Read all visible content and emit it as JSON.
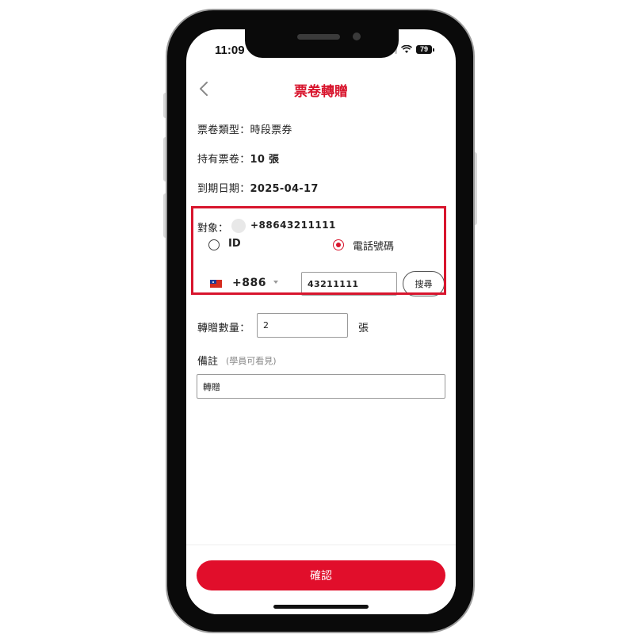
{
  "status_bar": {
    "time": "11:09",
    "battery": "79"
  },
  "nav": {
    "title": "票卷轉贈"
  },
  "ticket_info": {
    "type_label": "票卷類型：",
    "type_value": "時段票券",
    "held_label": "持有票卷：",
    "held_value": "10 張",
    "expiry_label": "到期日期：",
    "expiry_value": "2025-04-17"
  },
  "target": {
    "label": "對象：",
    "phone": "+88643211111",
    "options": [
      {
        "label": "ID",
        "selected": false
      },
      {
        "label": "電話號碼",
        "selected": true
      }
    ],
    "country_code": "+886",
    "phone_input_value": "43211111",
    "search_label": "搜尋"
  },
  "quantity": {
    "label": "轉贈數量：",
    "value": "2",
    "unit": "張"
  },
  "note": {
    "label": "備註",
    "hint": "(學員可看見)",
    "value": "轉贈"
  },
  "confirm_label": "確認",
  "colors": {
    "accent": "#d8152d",
    "button": "#e10e2b"
  }
}
